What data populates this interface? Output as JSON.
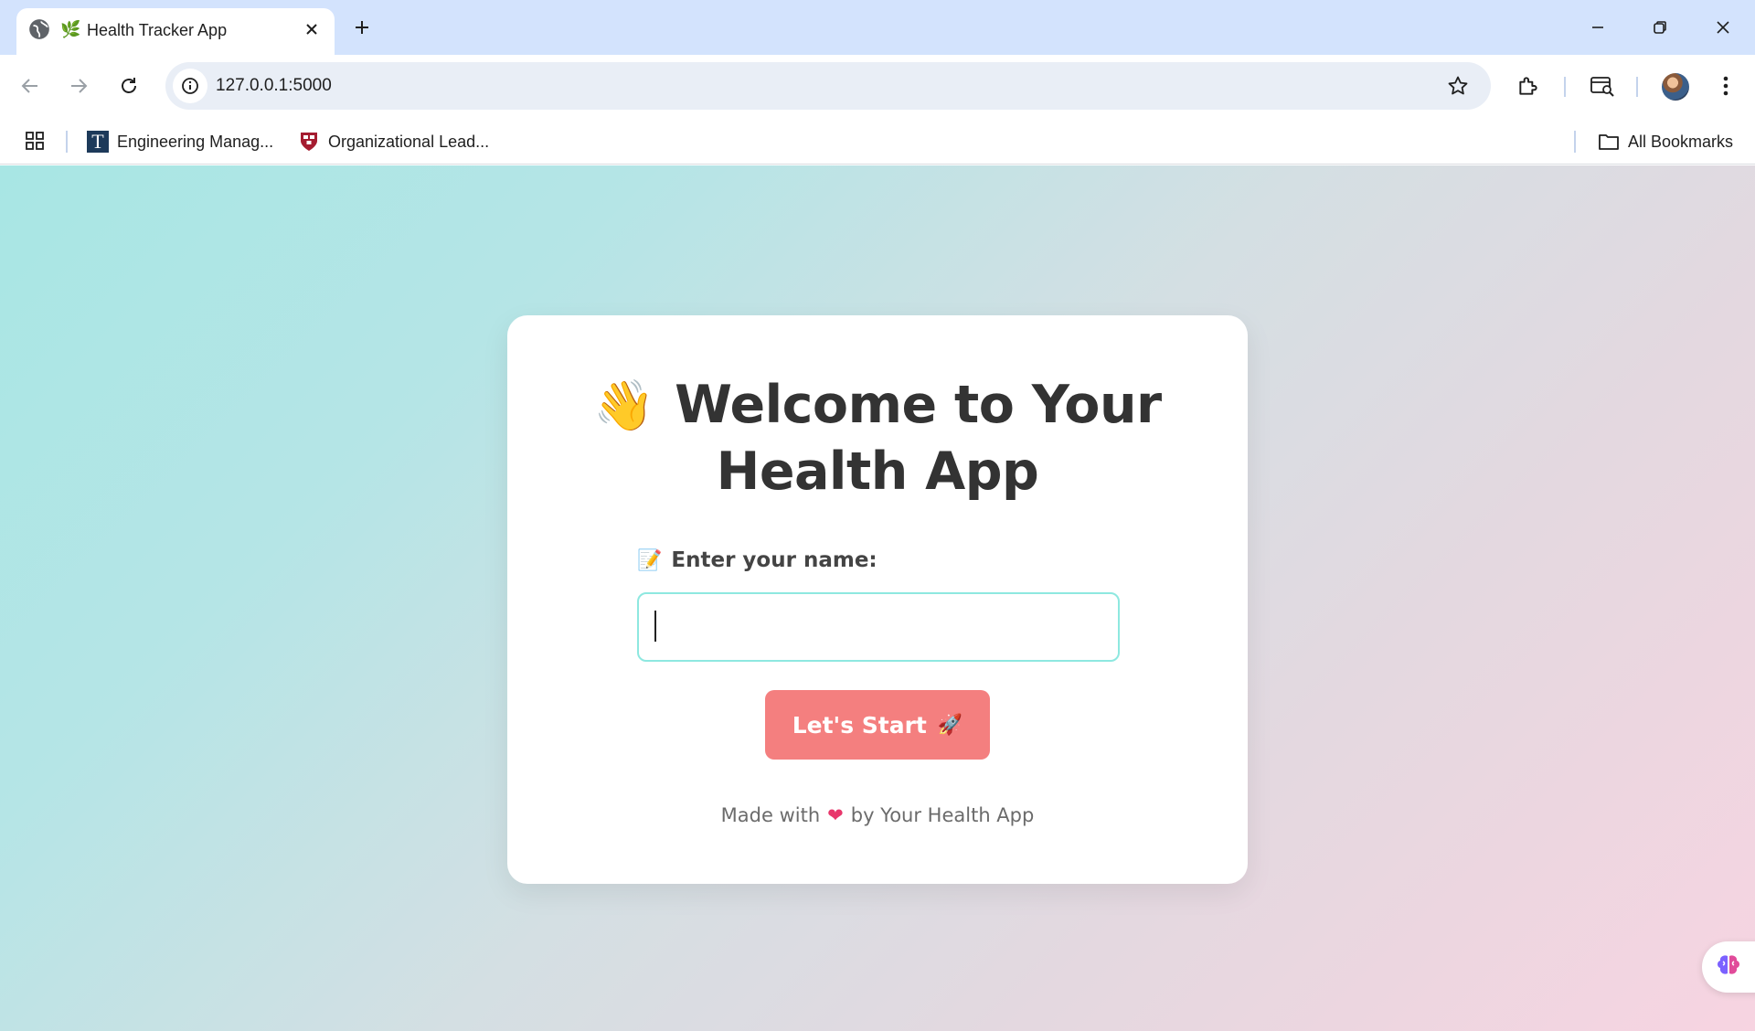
{
  "browser": {
    "tab": {
      "title": "Health Tracker App",
      "favicon": "🌿"
    },
    "url": "127.0.0.1:5000",
    "bookmarks": [
      {
        "label": "Engineering Manag...",
        "icon": "nyt-t-icon"
      },
      {
        "label": "Organizational Lead...",
        "icon": "harvard-shield-icon"
      }
    ],
    "all_bookmarks_label": "All Bookmarks"
  },
  "page": {
    "heading_emoji": "👋",
    "heading": "Welcome to Your Health App",
    "name_label_emoji": "📝",
    "name_label": "Enter your name:",
    "name_value": "",
    "start_button_label": "Let's Start",
    "start_button_emoji": "🚀",
    "footer_prefix": "Made with",
    "footer_heart": "❤",
    "footer_suffix": "by Your Health App"
  },
  "colors": {
    "accent_button": "#f47f7f",
    "input_border": "#8ee8e0",
    "gradient_start": "#a8e6e4",
    "gradient_end": "#f7d4e1"
  }
}
